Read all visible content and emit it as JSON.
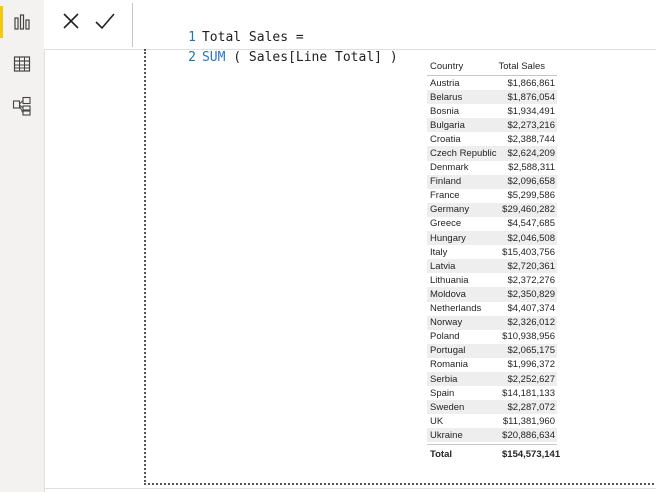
{
  "formula": {
    "line1_number": "1",
    "line1_text": "Total Sales =",
    "line2_number": "2",
    "line2_keyword": "SUM",
    "line2_text": " ( Sales[Line Total] )"
  },
  "table": {
    "headers": {
      "country": "Country",
      "total_sales": "Total Sales"
    },
    "rows": [
      {
        "country": "Austria",
        "sales": "$1,866,861"
      },
      {
        "country": "Belarus",
        "sales": "$1,876,054"
      },
      {
        "country": "Bosnia",
        "sales": "$1,934,491"
      },
      {
        "country": "Bulgaria",
        "sales": "$2,273,216"
      },
      {
        "country": "Croatia",
        "sales": "$2,388,744"
      },
      {
        "country": "Czech Republic",
        "sales": "$2,624,209"
      },
      {
        "country": "Denmark",
        "sales": "$2,588,311"
      },
      {
        "country": "Finland",
        "sales": "$2,096,658"
      },
      {
        "country": "France",
        "sales": "$5,299,586"
      },
      {
        "country": "Germany",
        "sales": "$29,460,282"
      },
      {
        "country": "Greece",
        "sales": "$4,547,685"
      },
      {
        "country": "Hungary",
        "sales": "$2,046,508"
      },
      {
        "country": "Italy",
        "sales": "$15,403,756"
      },
      {
        "country": "Latvia",
        "sales": "$2,720,361"
      },
      {
        "country": "Lithuania",
        "sales": "$2,372,276"
      },
      {
        "country": "Moldova",
        "sales": "$2,350,829"
      },
      {
        "country": "Netherlands",
        "sales": "$4,407,374"
      },
      {
        "country": "Norway",
        "sales": "$2,326,012"
      },
      {
        "country": "Poland",
        "sales": "$10,938,956"
      },
      {
        "country": "Portugal",
        "sales": "$2,065,175"
      },
      {
        "country": "Romania",
        "sales": "$1,996,372"
      },
      {
        "country": "Serbia",
        "sales": "$2,252,627"
      },
      {
        "country": "Spain",
        "sales": "$14,181,133"
      },
      {
        "country": "Sweden",
        "sales": "$2,287,072"
      },
      {
        "country": "UK",
        "sales": "$11,381,960"
      },
      {
        "country": "Ukraine",
        "sales": "$20,886,634"
      }
    ],
    "total": {
      "label": "Total",
      "value": "$154,573,141"
    }
  },
  "icons": {
    "report_view": "bar-chart-icon",
    "data_view": "table-grid-icon",
    "model_view": "model-diagram-icon",
    "cancel": "close-icon",
    "commit": "check-icon"
  },
  "colors": {
    "accent": "#f2c811",
    "keyword": "#2f74c0",
    "line_number": "#237893",
    "alt_row": "#eeeeee"
  }
}
